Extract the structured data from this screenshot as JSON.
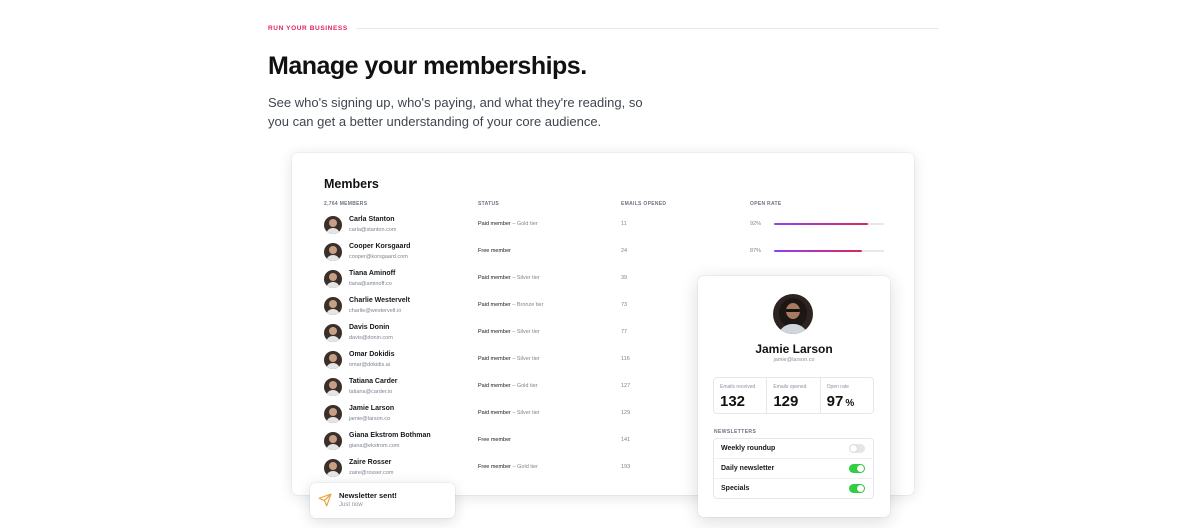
{
  "section": {
    "eyebrow": "RUN YOUR BUSINESS",
    "headline": "Manage your memberships.",
    "subhead": "See who's signing up, who's paying, and what they're reading, so you can get a better understanding of your core audience."
  },
  "members_table": {
    "title": "Members",
    "columns": {
      "members": "2,764 MEMBERS",
      "status": "STATUS",
      "emails_opened": "EMAILS OPENED",
      "open_rate": "OPEN RATE"
    },
    "rows": [
      {
        "name": "Carla Stanton",
        "email": "carla@stanton.com",
        "status": "Paid member",
        "tier": " – Gold tier",
        "emails_opened": "11",
        "open_rate": "92%",
        "open_rate_value": 0.85
      },
      {
        "name": "Cooper Korsgaard",
        "email": "cooper@korsgaard.com",
        "status": "Free member",
        "tier": "",
        "emails_opened": "24",
        "open_rate": "87%",
        "open_rate_value": 0.8
      },
      {
        "name": "Tiana Aminoff",
        "email": "tiana@aminoff.co",
        "status": "Paid member",
        "tier": " – Silver tier",
        "emails_opened": "39",
        "open_rate": "",
        "open_rate_value": null
      },
      {
        "name": "Charlie Westervelt",
        "email": "charlie@westervelt.io",
        "status": "Paid member",
        "tier": " – Bronze tier",
        "emails_opened": "73",
        "open_rate": "",
        "open_rate_value": null
      },
      {
        "name": "Davis Donin",
        "email": "davis@donin.com",
        "status": "Paid member",
        "tier": " – Silver tier",
        "emails_opened": "77",
        "open_rate": "",
        "open_rate_value": null
      },
      {
        "name": "Omar Dokidis",
        "email": "omar@dokidis.ai",
        "status": "Paid member",
        "tier": " – Silver tier",
        "emails_opened": "116",
        "open_rate": "",
        "open_rate_value": null
      },
      {
        "name": "Tatiana Carder",
        "email": "tatiana@carder.io",
        "status": "Paid member",
        "tier": " – Gold tier",
        "emails_opened": "127",
        "open_rate": "",
        "open_rate_value": null
      },
      {
        "name": "Jamie Larson",
        "email": "jamie@larson.co",
        "status": "Paid member",
        "tier": " – Silver tier",
        "emails_opened": "129",
        "open_rate": "",
        "open_rate_value": null
      },
      {
        "name": "Giana Ekstrom Bothman",
        "email": "giana@ekstrom.com",
        "status": "Free member",
        "tier": "",
        "emails_opened": "141",
        "open_rate": "",
        "open_rate_value": null
      },
      {
        "name": "Zaire Rosser",
        "email": "zaire@rosser.com",
        "status": "Free member",
        "tier": " – Gold tier",
        "emails_opened": "193",
        "open_rate": "",
        "open_rate_value": null
      }
    ]
  },
  "profile": {
    "name": "Jamie Larson",
    "email": "jamie@larson.co",
    "stats": [
      {
        "label": "Emails received",
        "value": "132",
        "suffix": ""
      },
      {
        "label": "Emails opened",
        "value": "129",
        "suffix": ""
      },
      {
        "label": "Open rate",
        "value": "97",
        "suffix": "%"
      }
    ],
    "newsletters_heading": "NEWSLETTERS",
    "newsletters": [
      {
        "label": "Weekly roundup",
        "enabled": false
      },
      {
        "label": "Daily newsletter",
        "enabled": true
      },
      {
        "label": "Specials",
        "enabled": true
      }
    ]
  },
  "toast": {
    "icon": "paper-plane-icon",
    "title": "Newsletter sent!",
    "subtitle": "Just now"
  },
  "colors": {
    "accent": "#e0245e",
    "gradient_start": "#8e42f5",
    "toggle_on": "#30cf43",
    "toast_icon": "#e8a33c"
  }
}
